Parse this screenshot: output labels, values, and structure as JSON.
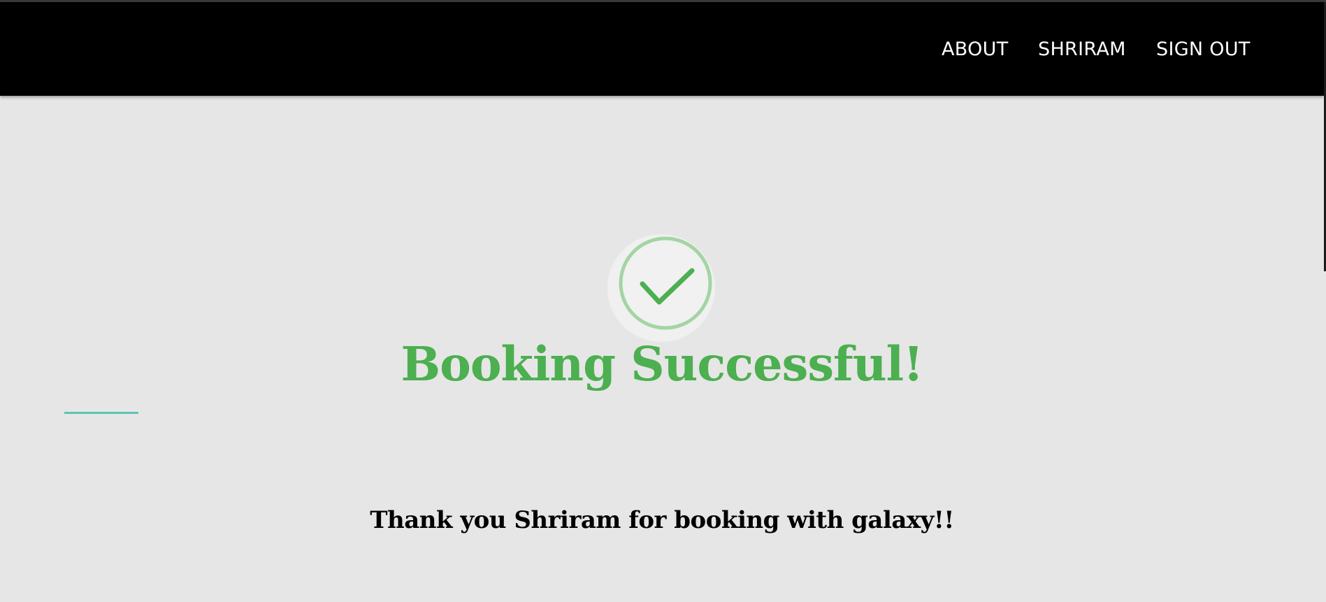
{
  "nav": {
    "items": [
      {
        "label": "ABOUT"
      },
      {
        "label": "SHRIRAM"
      },
      {
        "label": "SIGN OUT"
      }
    ]
  },
  "main": {
    "icon": "check-circle-icon",
    "title": "Booking Successful!",
    "message": "Thank you Shriram for booking with galaxy!!"
  },
  "colors": {
    "navbar": "#000000",
    "page_background": "#e6e6e6",
    "success": "#4caf50",
    "accent": "#5ec4b6",
    "nav_text": "#ffffff"
  }
}
